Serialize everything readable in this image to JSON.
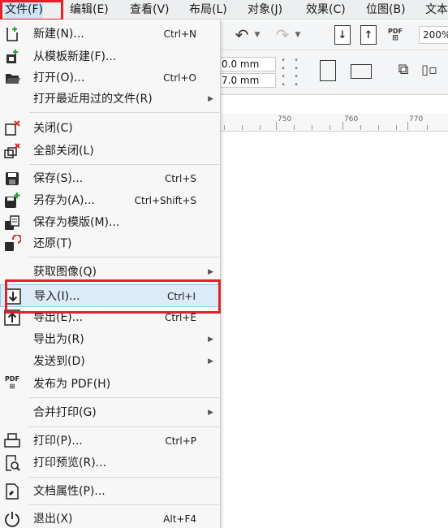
{
  "menubar": {
    "items": [
      "文件(F)",
      "编辑(E)",
      "查看(V)",
      "布局(L)",
      "对象(J)",
      "效果(C)",
      "位图(B)",
      "文本"
    ]
  },
  "toolbar": {
    "zoom": "200%",
    "pdf_label": "PDF",
    "fields": [
      "0.0 mm",
      "7.0 mm"
    ]
  },
  "ruler": {
    "labels": [
      "750",
      "760",
      "770"
    ]
  },
  "file_menu": {
    "items": [
      {
        "label": "新建(N)...",
        "shortcut": "Ctrl+N",
        "icon": "new-document-icon"
      },
      {
        "label": "从模板新建(F)...",
        "shortcut": "",
        "icon": "new-from-template-icon"
      },
      {
        "label": "打开(O)...",
        "shortcut": "Ctrl+O",
        "icon": "open-folder-icon"
      },
      {
        "label": "打开最近用过的文件(R)",
        "shortcut": "",
        "icon": ""
      },
      {
        "label": "关闭(C)",
        "shortcut": "",
        "icon": "close-document-icon"
      },
      {
        "label": "全部关闭(L)",
        "shortcut": "",
        "icon": "close-all-icon"
      },
      {
        "label": "保存(S)...",
        "shortcut": "Ctrl+S",
        "icon": "save-icon"
      },
      {
        "label": "另存为(A)...",
        "shortcut": "Ctrl+Shift+S",
        "icon": "save-as-icon"
      },
      {
        "label": "保存为模版(M)...",
        "shortcut": "",
        "icon": "save-template-icon"
      },
      {
        "label": "还原(T)",
        "shortcut": "",
        "icon": "revert-icon"
      },
      {
        "label": "获取图像(Q)",
        "shortcut": "",
        "icon": ""
      },
      {
        "label": "导入(I)...",
        "shortcut": "Ctrl+I",
        "icon": "import-icon"
      },
      {
        "label": "导出(E)...",
        "shortcut": "Ctrl+E",
        "icon": "export-icon"
      },
      {
        "label": "导出为(R)",
        "shortcut": "",
        "icon": ""
      },
      {
        "label": "发送到(D)",
        "shortcut": "",
        "icon": ""
      },
      {
        "label": "发布为 PDF(H)",
        "shortcut": "",
        "icon": "pdf-icon"
      },
      {
        "label": "合并打印(G)",
        "shortcut": "",
        "icon": ""
      },
      {
        "label": "打印(P)...",
        "shortcut": "Ctrl+P",
        "icon": "print-icon"
      },
      {
        "label": "打印预览(R)...",
        "shortcut": "",
        "icon": "print-preview-icon"
      },
      {
        "label": "文档属性(P)...",
        "shortcut": "",
        "icon": "document-properties-icon"
      },
      {
        "label": "退出(X)",
        "shortcut": "Alt+F4",
        "icon": "exit-icon"
      }
    ]
  }
}
